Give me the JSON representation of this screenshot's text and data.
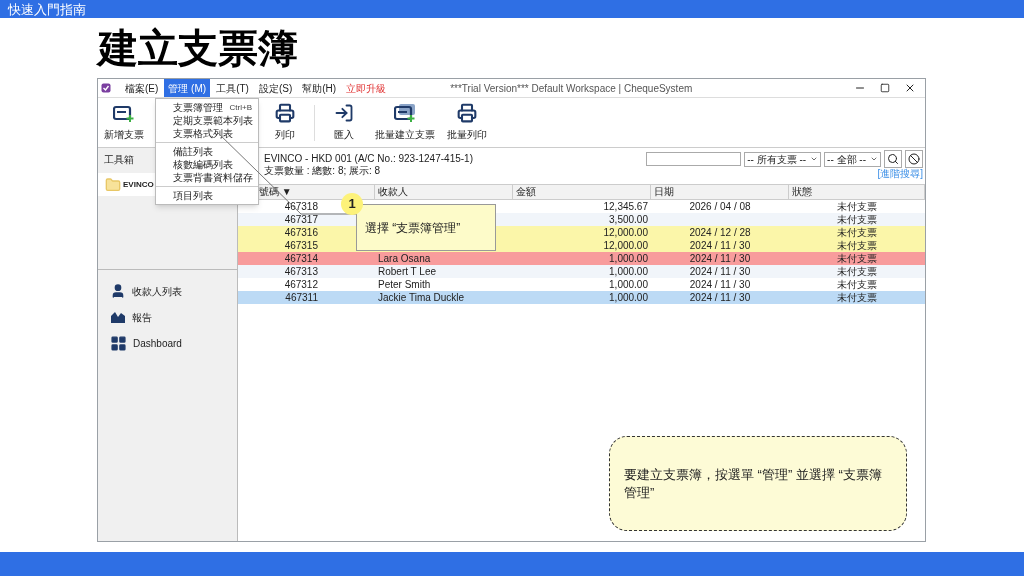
{
  "header_bar": {
    "title": "快速入門指南"
  },
  "page_title": "建立支票簿",
  "window": {
    "title": "***Trial Version*** Default Workspace | ChequeSystem",
    "menu": [
      {
        "label": "檔案(E)",
        "selected": false,
        "kind": "menu"
      },
      {
        "label": "管理 (M)",
        "selected": true,
        "kind": "menu"
      },
      {
        "label": "工具(T)",
        "selected": false,
        "kind": "menu"
      },
      {
        "label": "設定(S)",
        "selected": false,
        "kind": "menu"
      },
      {
        "label": "幫助(H)",
        "selected": false,
        "kind": "menu"
      },
      {
        "label": "立即升級",
        "selected": false,
        "kind": "upgrade"
      }
    ]
  },
  "dropdown_menu": {
    "sections": [
      [
        {
          "label": "支票簿管理",
          "shortcut": "Ctrl+B"
        },
        {
          "label": "定期支票範本列表"
        },
        {
          "label": "支票格式列表"
        }
      ],
      [
        {
          "label": "備註列表"
        },
        {
          "label": "核數編碼列表"
        },
        {
          "label": "支票背書資料儲存"
        }
      ],
      [
        {
          "label": "項目列表"
        }
      ]
    ]
  },
  "toolbar": [
    {
      "label": "新增支票",
      "kind": "new"
    },
    {
      "label": "列印",
      "kind": "print"
    },
    {
      "label": "匯入",
      "kind": "import"
    },
    {
      "label": "批量建立支票",
      "kind": "batch-new"
    },
    {
      "label": "批量列印",
      "kind": "batch-print"
    }
  ],
  "sidebar": {
    "title": "工具箱",
    "folder": "EVINCO",
    "nav": [
      {
        "label": "收款人列表",
        "kind": "payees"
      },
      {
        "label": "報告",
        "kind": "report"
      },
      {
        "label": "Dashboard",
        "kind": "dashboard"
      }
    ]
  },
  "account": {
    "name": "EVINCO - HKD 001 (A/C No.: 923-1247-415-1)",
    "summary": "支票數量 : 總數: 8; 展示: 8"
  },
  "filters": {
    "selects": [
      "-- 所有支票 --",
      "-- 全部 --"
    ],
    "advanced_search": "[進階搜尋]"
  },
  "table": {
    "columns": [
      "號碼 ▼",
      "收款人",
      "金額",
      "日期",
      "狀態"
    ],
    "rows": [
      {
        "cells": [
          "467318",
          "",
          "12,345.67",
          "2026 / 04 / 08",
          "未付支票"
        ],
        "color": "#ffffff"
      },
      {
        "cells": [
          "467317",
          "",
          "3,500.00",
          "",
          "未付支票"
        ],
        "color": "#f1f5fa"
      },
      {
        "cells": [
          "467316",
          "",
          "12,000.00",
          "2024 / 12 / 28",
          "未付支票"
        ],
        "color": "#fbf6a9"
      },
      {
        "cells": [
          "467315",
          "",
          "12,000.00",
          "2024 / 11 / 30",
          "未付支票"
        ],
        "color": "#fbf6a9"
      },
      {
        "cells": [
          "467314",
          "Lara Osana",
          "1,000.00",
          "2024 / 11 / 30",
          "未付支票"
        ],
        "color": "#f89c9c"
      },
      {
        "cells": [
          "467313",
          "Robert T Lee",
          "1,000.00",
          "2024 / 11 / 30",
          "未付支票"
        ],
        "color": "#f1f5fa"
      },
      {
        "cells": [
          "467312",
          "Peter Smith",
          "1,000.00",
          "2024 / 11 / 30",
          "未付支票"
        ],
        "color": "#ffffff"
      },
      {
        "cells": [
          "467311",
          "Jackie Tima Duckle",
          "1,000.00",
          "2024 / 11 / 30",
          "未付支票"
        ],
        "color": "#bcdaf5"
      }
    ]
  },
  "callout": {
    "number": "1",
    "text": "選擇 “支票簿管理”"
  },
  "note": {
    "text": "要建立支票簿，按選單 “管理” 並選擇 “支票簿管理”"
  }
}
